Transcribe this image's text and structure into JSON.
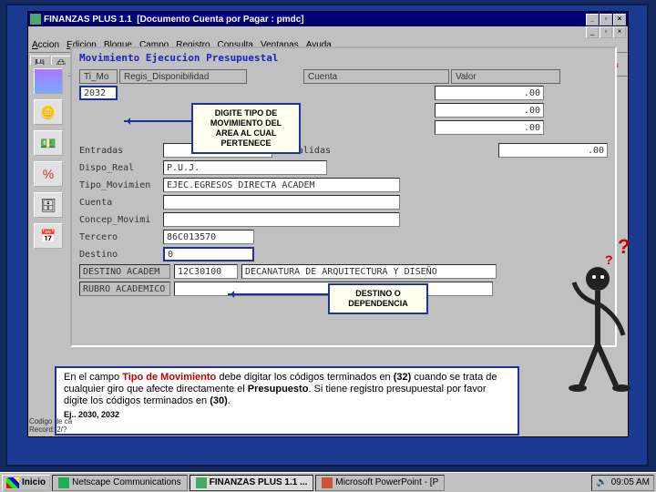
{
  "app": {
    "title": "FINANZAS PLUS 1.1",
    "document": "[Documento Cuenta por Pagar : pmdc]",
    "logo": "FINANZAS"
  },
  "menu": {
    "accion": "Accion",
    "edicion": "Edicion",
    "bloque": "Bloque",
    "campo": "Campo",
    "registro": "Registro",
    "consulta": "Consulta",
    "ventanas": "Ventanas",
    "ayuda": "Ayuda"
  },
  "toolbar_glyphs": {
    "save": "💾",
    "print": "🖨",
    "cut": "✂",
    "copy": "⎘",
    "paste": "📋",
    "first": "|◀",
    "prev": "◀",
    "next": "▶",
    "last": "▶|",
    "up": "▲",
    "down": "▼",
    "commit": "✓",
    "rollback": "⟲",
    "ins": "⇩",
    "del": "⇧",
    "exec": "?",
    "exit": "✕"
  },
  "form": {
    "title": "Movimiento Ejecucion Presupuestal",
    "headers": {
      "ti_mo": "Ti_Mo",
      "regis": "Regis_Disponibilidad",
      "cuenta": "Cuenta",
      "valor": "Valor"
    },
    "ti_mo_val": "2032",
    "zero": ".00",
    "labels": {
      "entradas": "Entradas",
      "salidas": "Salidas",
      "dispo_real": "Dispo_Real",
      "tipo_mov": "Tipo_Movimien",
      "cuenta": "Cuenta",
      "concep": "Concep_Movimi",
      "tercero": "Tercero",
      "destino": "Destino",
      "destino_academ": "DESTINO ACADEM",
      "rubro": "RUBRO ACADEMICO"
    },
    "dispo_real_val": "P.U.J.",
    "tipo_mov_val": "EJEC.EGRESOS DIRECTA ACADEM",
    "tercero_val": "86C013570",
    "destino_val": "0",
    "destino_academ_code": "12C30100",
    "destino_academ_desc": "DECANATURA DE ARQUITECTURA Y DISEÑO"
  },
  "callouts": {
    "tipo": "DIGITE TIPO DE\nMOVIMIENTO DEL\nAREA AL CUAL\nPERTENECE",
    "destino": "DESTINO O\nDEPENDENCIA"
  },
  "help": {
    "p1a": "En el campo ",
    "p1b": "Tipo de Movimiento",
    "p1c": " debe digitar los códigos terminados en ",
    "p1d": "(32)",
    "p1e": " cuando se trata de cualquier giro que afecte directamente el ",
    "p1f": "Presupuesto",
    "p1g": ". Si tiene registro presupuestal por favor digite los códigos terminados en ",
    "p1h": "(30)",
    "p1i": ".",
    "ex": "Ej.. 2030, 2032"
  },
  "status": {
    "l1": "Codigo de ca",
    "l2": "Record: 2/?"
  },
  "taskbar": {
    "start": "Inicio",
    "tasks": [
      {
        "label": "Netscape Communications",
        "active": false
      },
      {
        "label": "FINANZAS PLUS 1.1 ...",
        "active": true
      },
      {
        "label": "Microsoft PowerPoint - [P",
        "active": false
      }
    ],
    "clock": "09:05 AM"
  }
}
